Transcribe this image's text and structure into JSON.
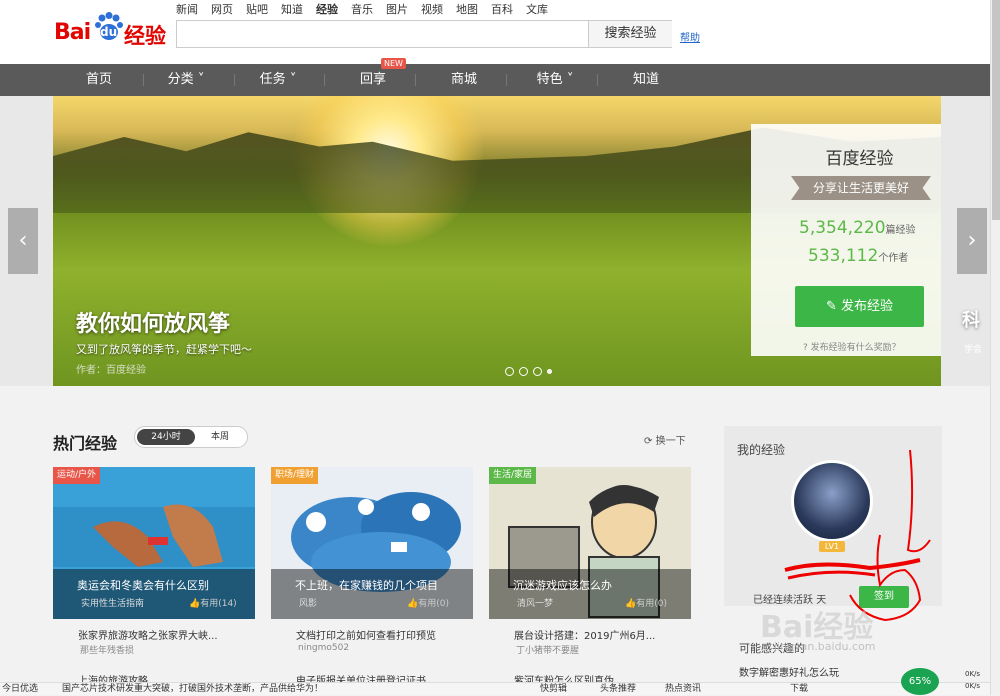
{
  "header": {
    "logo_text_bai": "Bai",
    "logo_text_du": "du",
    "logo_text_jy": "经验",
    "nav_links": [
      "新闻",
      "网页",
      "贴吧",
      "知道",
      "经验",
      "音乐",
      "图片",
      "视频",
      "地图",
      "百科",
      "文库"
    ],
    "active_link": "经验",
    "search_placeholder": "",
    "search_button": "搜索经验",
    "help_link": "帮助"
  },
  "main_nav": {
    "items": [
      "首页",
      "分类",
      "任务",
      "回享",
      "商城",
      "特色",
      "知道"
    ],
    "new_badge": "NEW"
  },
  "banner": {
    "title": "教你如何放风筝",
    "subtitle": "又到了放风筝的季节，赶紧学下吧～",
    "author": "作者：百度经验",
    "side_title": "科",
    "side_sub": "学会",
    "stat_title": "百度经验",
    "slogan": "分享让生活更美好",
    "exp_count": "5,354,220",
    "exp_label": "篇经验",
    "author_count": "533,112",
    "author_label": "个作者",
    "publish_button": "发布经验",
    "publish_hint": "发布经验有什么奖励？"
  },
  "hot": {
    "title": "热门经验",
    "tab_24h": "24小时",
    "tab_week": "本周",
    "refresh": "换一下",
    "cards": [
      {
        "category": "运动/户外",
        "title": "奥运会和冬奥会有什么区别",
        "source": "实用性生活指南",
        "likes": "有用(14)",
        "cat_color": "#e8564a"
      },
      {
        "category": "职场/理财",
        "title": "不上班，在家赚钱的几个项目",
        "source": "风影",
        "likes": "有用(0)",
        "cat_color": "#f0a030"
      },
      {
        "category": "生活/家居",
        "title": "沉迷游戏应该怎么办",
        "source": "清风一梦",
        "likes": "有用(0)",
        "cat_color": "#5cb848"
      }
    ],
    "below": [
      {
        "title": "张家界旅游攻略之张家界大峡...",
        "author": "那些年残香损"
      },
      {
        "title": "文档打印之前如何查看打印预览",
        "author": "ningmo502"
      },
      {
        "title": "展台设计搭建：2019广州6月...",
        "author": "丁小猪带不要腥"
      }
    ],
    "below_row2": [
      "上海的旅游攻略",
      "电子版报关单位注册登记证书",
      "紫河车粉怎么区别真伪"
    ]
  },
  "my_exp": {
    "title": "我的经验",
    "level": "LV1",
    "continuous": "已经连续活跃",
    "days": "天",
    "sign_button": "签到",
    "maybe_title": "可能感兴趣的",
    "maybe_item": "数字解密惠好礼怎么玩",
    "watermark": "Bai经验",
    "watermark_url": "jingyan.baidu.com"
  },
  "taskbar": {
    "left": "今日优选",
    "news": "国产芯片技术研发重大突破，打破国外技术垄断，产品供给华为！",
    "kuaijian": "快剪辑",
    "toutiao": "头条推荐",
    "hot": "热点资讯",
    "download": "下载",
    "pct": "65%",
    "speed_up": "0K/s",
    "speed_down": "0K/s"
  }
}
